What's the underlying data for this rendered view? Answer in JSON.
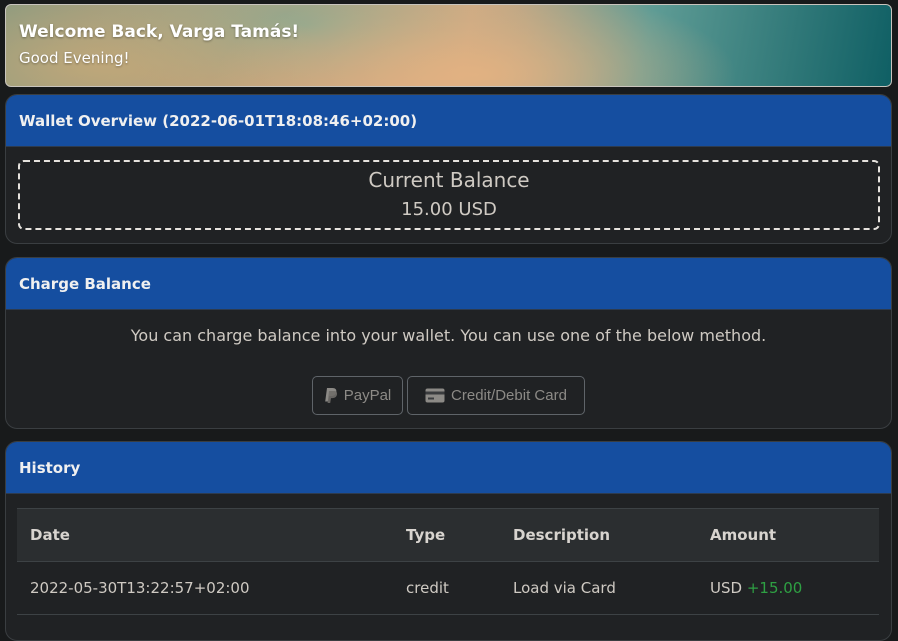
{
  "banner": {
    "title": "Welcome Back, Varga Tamás!",
    "subtitle": "Good Evening!"
  },
  "wallet": {
    "header": "Wallet Overview (2022-06-01T18:08:46+02:00)",
    "balance_label": "Current Balance",
    "balance_value": "15.00 USD"
  },
  "charge": {
    "header": "Charge Balance",
    "description": "You can charge balance into your wallet. You can use one of the below method.",
    "paypal_label": "PayPal",
    "paypal_icon": "paypal-icon",
    "card_label": "Credit/Debit Card",
    "card_icon": "credit-card-icon"
  },
  "history": {
    "header": "History",
    "columns": [
      "Date",
      "Type",
      "Description",
      "Amount"
    ],
    "rows": [
      {
        "date": "2022-05-30T13:22:57+02:00",
        "type": "credit",
        "description": "Load via Card",
        "currency": "USD",
        "amount": "+15.00"
      }
    ]
  },
  "colors": {
    "header_blue": "#154ea0",
    "positive_green": "#2ea043",
    "background": "#181a1b"
  }
}
